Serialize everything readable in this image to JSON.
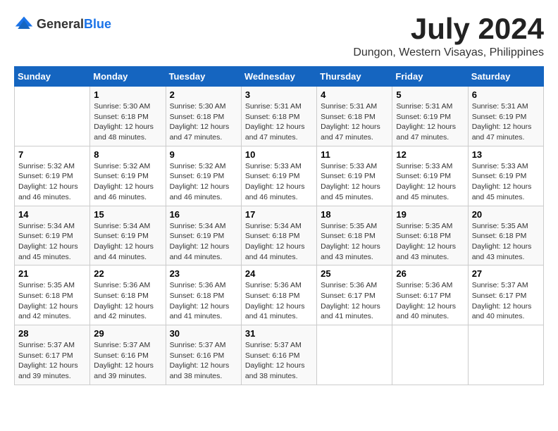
{
  "header": {
    "logo_general": "General",
    "logo_blue": "Blue",
    "month_year": "July 2024",
    "location": "Dungon, Western Visayas, Philippines"
  },
  "weekdays": [
    "Sunday",
    "Monday",
    "Tuesday",
    "Wednesday",
    "Thursday",
    "Friday",
    "Saturday"
  ],
  "weeks": [
    [
      {
        "day": "",
        "sunrise": "",
        "sunset": "",
        "daylight": ""
      },
      {
        "day": "1",
        "sunrise": "Sunrise: 5:30 AM",
        "sunset": "Sunset: 6:18 PM",
        "daylight": "Daylight: 12 hours and 48 minutes."
      },
      {
        "day": "2",
        "sunrise": "Sunrise: 5:30 AM",
        "sunset": "Sunset: 6:18 PM",
        "daylight": "Daylight: 12 hours and 47 minutes."
      },
      {
        "day": "3",
        "sunrise": "Sunrise: 5:31 AM",
        "sunset": "Sunset: 6:18 PM",
        "daylight": "Daylight: 12 hours and 47 minutes."
      },
      {
        "day": "4",
        "sunrise": "Sunrise: 5:31 AM",
        "sunset": "Sunset: 6:18 PM",
        "daylight": "Daylight: 12 hours and 47 minutes."
      },
      {
        "day": "5",
        "sunrise": "Sunrise: 5:31 AM",
        "sunset": "Sunset: 6:19 PM",
        "daylight": "Daylight: 12 hours and 47 minutes."
      },
      {
        "day": "6",
        "sunrise": "Sunrise: 5:31 AM",
        "sunset": "Sunset: 6:19 PM",
        "daylight": "Daylight: 12 hours and 47 minutes."
      }
    ],
    [
      {
        "day": "7",
        "sunrise": "Sunrise: 5:32 AM",
        "sunset": "Sunset: 6:19 PM",
        "daylight": "Daylight: 12 hours and 46 minutes."
      },
      {
        "day": "8",
        "sunrise": "Sunrise: 5:32 AM",
        "sunset": "Sunset: 6:19 PM",
        "daylight": "Daylight: 12 hours and 46 minutes."
      },
      {
        "day": "9",
        "sunrise": "Sunrise: 5:32 AM",
        "sunset": "Sunset: 6:19 PM",
        "daylight": "Daylight: 12 hours and 46 minutes."
      },
      {
        "day": "10",
        "sunrise": "Sunrise: 5:33 AM",
        "sunset": "Sunset: 6:19 PM",
        "daylight": "Daylight: 12 hours and 46 minutes."
      },
      {
        "day": "11",
        "sunrise": "Sunrise: 5:33 AM",
        "sunset": "Sunset: 6:19 PM",
        "daylight": "Daylight: 12 hours and 45 minutes."
      },
      {
        "day": "12",
        "sunrise": "Sunrise: 5:33 AM",
        "sunset": "Sunset: 6:19 PM",
        "daylight": "Daylight: 12 hours and 45 minutes."
      },
      {
        "day": "13",
        "sunrise": "Sunrise: 5:33 AM",
        "sunset": "Sunset: 6:19 PM",
        "daylight": "Daylight: 12 hours and 45 minutes."
      }
    ],
    [
      {
        "day": "14",
        "sunrise": "Sunrise: 5:34 AM",
        "sunset": "Sunset: 6:19 PM",
        "daylight": "Daylight: 12 hours and 45 minutes."
      },
      {
        "day": "15",
        "sunrise": "Sunrise: 5:34 AM",
        "sunset": "Sunset: 6:19 PM",
        "daylight": "Daylight: 12 hours and 44 minutes."
      },
      {
        "day": "16",
        "sunrise": "Sunrise: 5:34 AM",
        "sunset": "Sunset: 6:19 PM",
        "daylight": "Daylight: 12 hours and 44 minutes."
      },
      {
        "day": "17",
        "sunrise": "Sunrise: 5:34 AM",
        "sunset": "Sunset: 6:18 PM",
        "daylight": "Daylight: 12 hours and 44 minutes."
      },
      {
        "day": "18",
        "sunrise": "Sunrise: 5:35 AM",
        "sunset": "Sunset: 6:18 PM",
        "daylight": "Daylight: 12 hours and 43 minutes."
      },
      {
        "day": "19",
        "sunrise": "Sunrise: 5:35 AM",
        "sunset": "Sunset: 6:18 PM",
        "daylight": "Daylight: 12 hours and 43 minutes."
      },
      {
        "day": "20",
        "sunrise": "Sunrise: 5:35 AM",
        "sunset": "Sunset: 6:18 PM",
        "daylight": "Daylight: 12 hours and 43 minutes."
      }
    ],
    [
      {
        "day": "21",
        "sunrise": "Sunrise: 5:35 AM",
        "sunset": "Sunset: 6:18 PM",
        "daylight": "Daylight: 12 hours and 42 minutes."
      },
      {
        "day": "22",
        "sunrise": "Sunrise: 5:36 AM",
        "sunset": "Sunset: 6:18 PM",
        "daylight": "Daylight: 12 hours and 42 minutes."
      },
      {
        "day": "23",
        "sunrise": "Sunrise: 5:36 AM",
        "sunset": "Sunset: 6:18 PM",
        "daylight": "Daylight: 12 hours and 41 minutes."
      },
      {
        "day": "24",
        "sunrise": "Sunrise: 5:36 AM",
        "sunset": "Sunset: 6:18 PM",
        "daylight": "Daylight: 12 hours and 41 minutes."
      },
      {
        "day": "25",
        "sunrise": "Sunrise: 5:36 AM",
        "sunset": "Sunset: 6:17 PM",
        "daylight": "Daylight: 12 hours and 41 minutes."
      },
      {
        "day": "26",
        "sunrise": "Sunrise: 5:36 AM",
        "sunset": "Sunset: 6:17 PM",
        "daylight": "Daylight: 12 hours and 40 minutes."
      },
      {
        "day": "27",
        "sunrise": "Sunrise: 5:37 AM",
        "sunset": "Sunset: 6:17 PM",
        "daylight": "Daylight: 12 hours and 40 minutes."
      }
    ],
    [
      {
        "day": "28",
        "sunrise": "Sunrise: 5:37 AM",
        "sunset": "Sunset: 6:17 PM",
        "daylight": "Daylight: 12 hours and 39 minutes."
      },
      {
        "day": "29",
        "sunrise": "Sunrise: 5:37 AM",
        "sunset": "Sunset: 6:16 PM",
        "daylight": "Daylight: 12 hours and 39 minutes."
      },
      {
        "day": "30",
        "sunrise": "Sunrise: 5:37 AM",
        "sunset": "Sunset: 6:16 PM",
        "daylight": "Daylight: 12 hours and 38 minutes."
      },
      {
        "day": "31",
        "sunrise": "Sunrise: 5:37 AM",
        "sunset": "Sunset: 6:16 PM",
        "daylight": "Daylight: 12 hours and 38 minutes."
      },
      {
        "day": "",
        "sunrise": "",
        "sunset": "",
        "daylight": ""
      },
      {
        "day": "",
        "sunrise": "",
        "sunset": "",
        "daylight": ""
      },
      {
        "day": "",
        "sunrise": "",
        "sunset": "",
        "daylight": ""
      }
    ]
  ]
}
